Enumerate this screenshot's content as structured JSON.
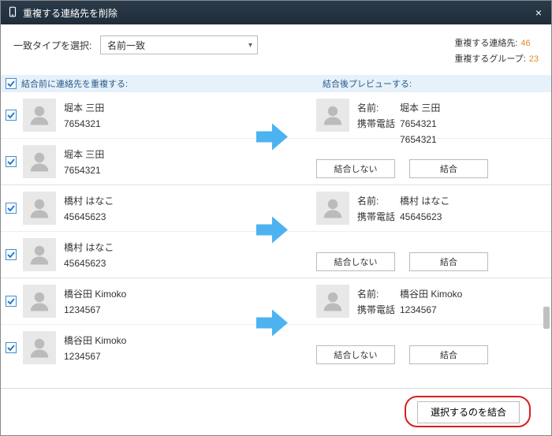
{
  "title": "重複する連絡先を削除",
  "matchTypeLabel": "一致タイプを選択:",
  "matchTypeValue": "名前一致",
  "stats": {
    "dupContactsLabel": "重複する連絡先:",
    "dupContactsValue": "46",
    "dupGroupsLabel": "重複するグループ:",
    "dupGroupsValue": "23"
  },
  "header": {
    "col1": "結合前に連絡先を重複する:",
    "col2": "結合後プレビューする:"
  },
  "labels": {
    "name": "名前:",
    "phone": "携帯電話",
    "dontMerge": "結合しない",
    "merge": "結合",
    "mergeSelected": "選択するのを結合"
  },
  "groups": [
    {
      "sources": [
        {
          "name": "堀本 三田",
          "phone": "7654321"
        },
        {
          "name": "堀本 三田",
          "phone": "7654321"
        }
      ],
      "preview": {
        "name": "堀本 三田",
        "phones": [
          "7654321",
          "7654321"
        ]
      }
    },
    {
      "sources": [
        {
          "name": "橋村 はなこ",
          "phone": "45645623"
        },
        {
          "name": "橋村 はなこ",
          "phone": "45645623"
        }
      ],
      "preview": {
        "name": "橋村 はなこ",
        "phones": [
          "45645623"
        ]
      }
    },
    {
      "sources": [
        {
          "name": "橋谷田 Kimoko",
          "phone": "1234567"
        },
        {
          "name": "橋谷田 Kimoko",
          "phone": "1234567"
        }
      ],
      "preview": {
        "name": "橋谷田 Kimoko",
        "phones": [
          "1234567"
        ]
      }
    }
  ]
}
